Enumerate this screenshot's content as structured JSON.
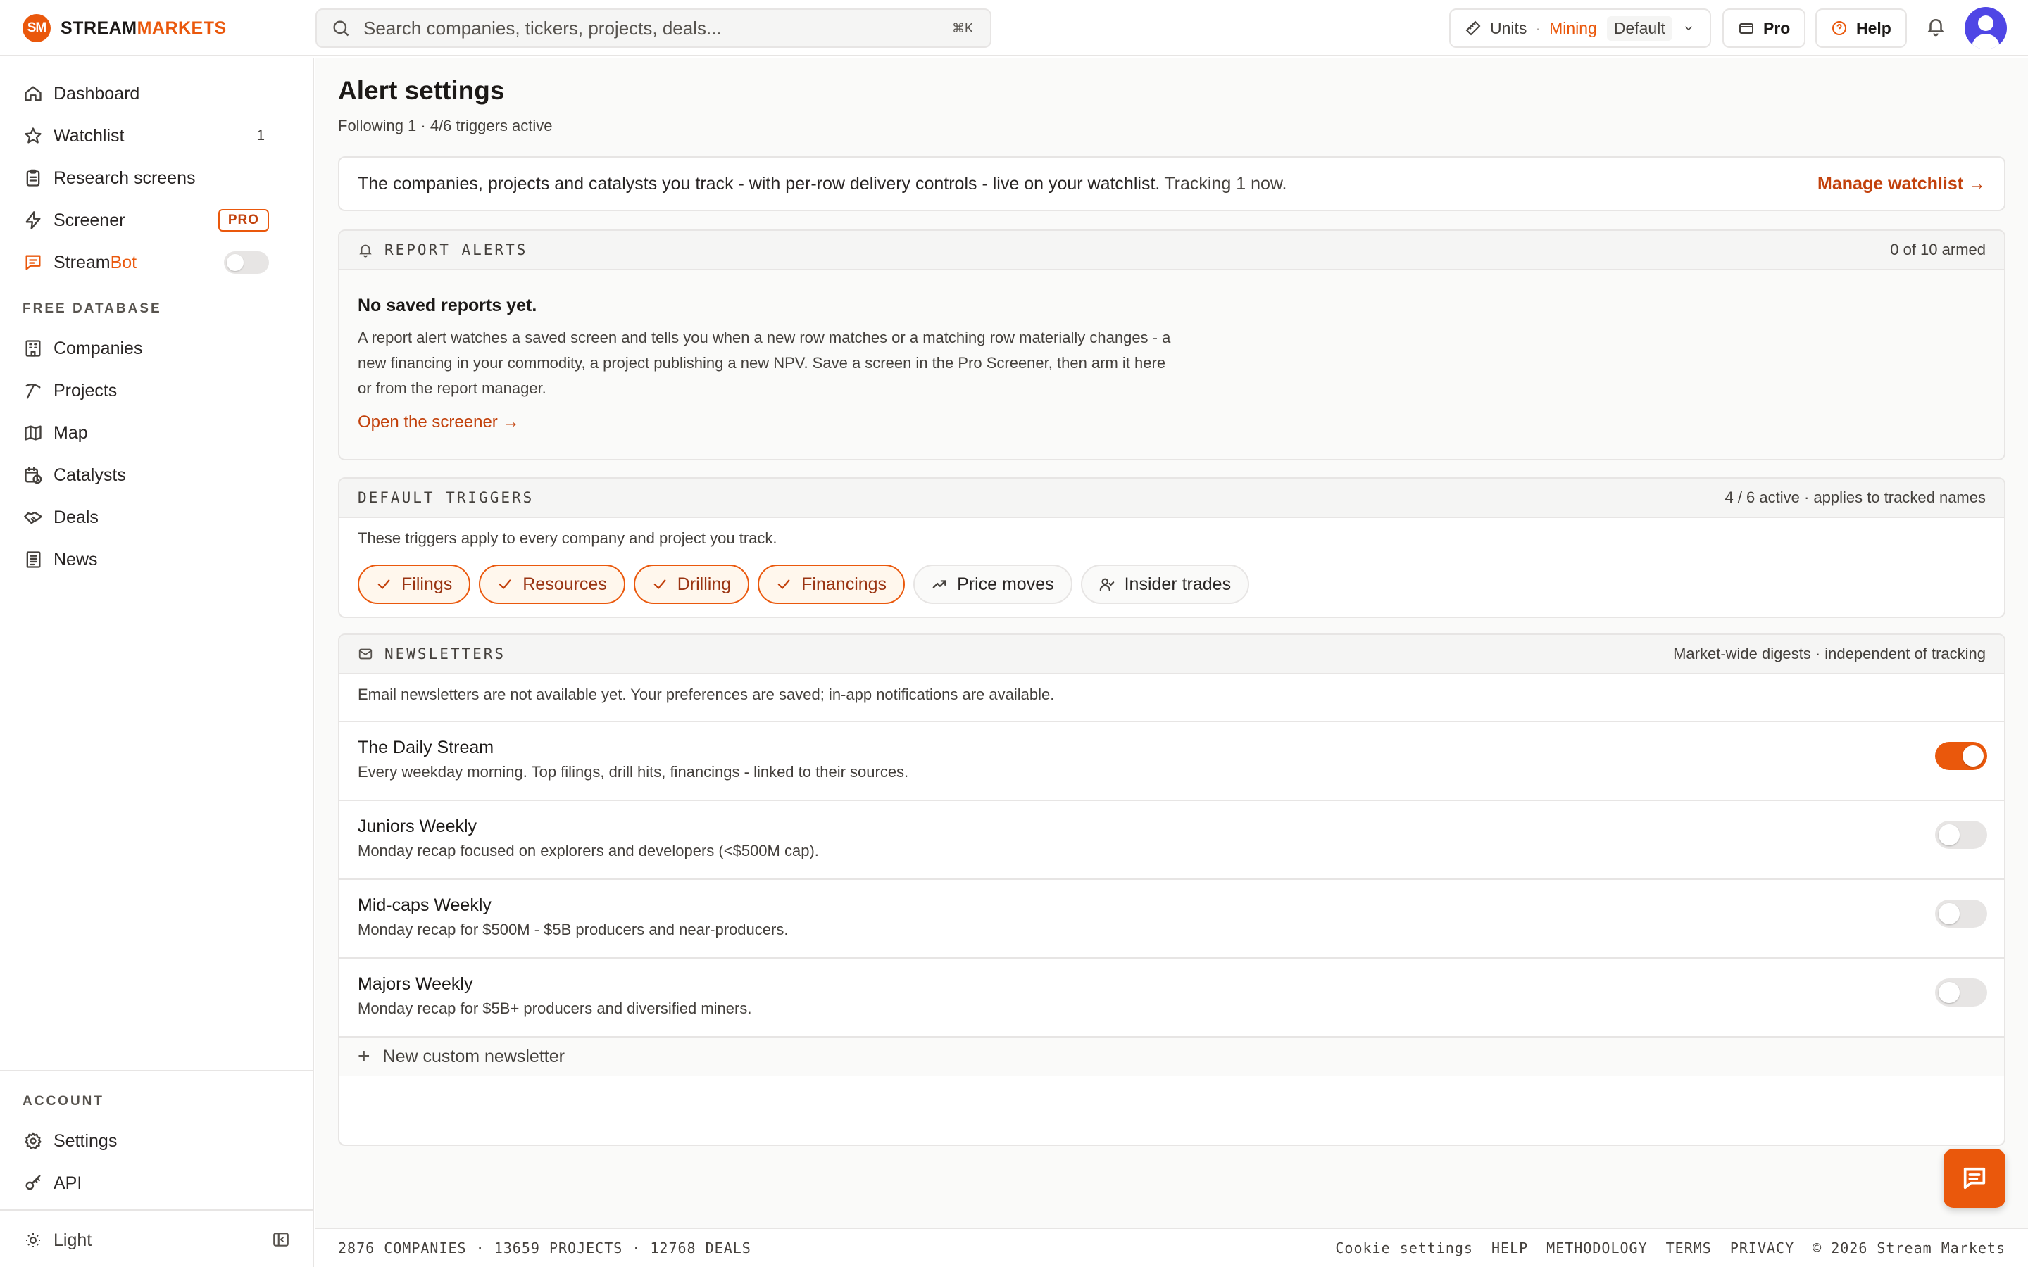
{
  "brand": {
    "badge": "SM",
    "name_a": "STREAM",
    "name_b": "MARKETS"
  },
  "search": {
    "placeholder": "Search companies, tickers, projects, deals...",
    "shortcut": "⌘K"
  },
  "topbar": {
    "units_label": "Units",
    "units_dot": "·",
    "units_sector": "Mining",
    "units_preset": "Default",
    "pro_label": "Pro",
    "help_label": "Help"
  },
  "sidebar": {
    "main_items": [
      {
        "label": "Dashboard",
        "icon": "home-icon"
      },
      {
        "label": "Watchlist",
        "icon": "star-icon",
        "count": "1"
      },
      {
        "label": "Research screens",
        "icon": "clipboard-icon"
      },
      {
        "label": "Screener",
        "icon": "lightning-icon",
        "badge": "PRO"
      },
      {
        "label_a": "Stream",
        "label_b": "Bot",
        "icon": "chat-icon"
      }
    ],
    "free_db_label": "FREE DATABASE",
    "db_items": [
      {
        "label": "Companies",
        "icon": "building-icon"
      },
      {
        "label": "Projects",
        "icon": "pickaxe-icon"
      },
      {
        "label": "Map",
        "icon": "map-icon"
      },
      {
        "label": "Catalysts",
        "icon": "calendar-clock-icon"
      },
      {
        "label": "Deals",
        "icon": "handshake-icon"
      },
      {
        "label": "News",
        "icon": "newspaper-icon"
      }
    ],
    "account_label": "ACCOUNT",
    "account_items": [
      {
        "label": "Settings",
        "icon": "gear-icon"
      },
      {
        "label": "API",
        "icon": "key-icon"
      }
    ],
    "theme_label": "Light"
  },
  "page": {
    "title": "Alert settings",
    "subtitle": "Following 1 · 4/6 triggers active"
  },
  "watch_info": {
    "text": "The companies, projects and catalysts you track - with per-row delivery controls - live on your watchlist.",
    "tracking": "Tracking 1 now.",
    "link": "Manage watchlist →"
  },
  "report_alerts": {
    "label": "REPORT ALERTS",
    "meta": "0 of 10 armed",
    "empty_title": "No saved reports yet.",
    "empty_desc": "A report alert watches a saved screen and tells you when a new row matches or a matching row materially changes - a new financing in your commodity, a project publishing a new NPV. Save a screen in the Pro Screener, then arm it here or from the report manager.",
    "link": "Open the screener →"
  },
  "default_triggers": {
    "label": "DEFAULT TRIGGERS",
    "meta": "4 / 6 active · applies to tracked names",
    "desc": "These triggers apply to every company and project you track.",
    "chips": [
      {
        "label": "Filings",
        "active": true
      },
      {
        "label": "Resources",
        "active": true
      },
      {
        "label": "Drilling",
        "active": true
      },
      {
        "label": "Financings",
        "active": true
      },
      {
        "label": "Price moves",
        "active": false
      },
      {
        "label": "Insider trades",
        "active": false
      }
    ]
  },
  "newsletters": {
    "label": "NEWSLETTERS",
    "meta": "Market-wide digests · independent of tracking",
    "note": "Email newsletters are not available yet. Your preferences are saved; in-app notifications are available.",
    "items": [
      {
        "title": "The Daily Stream",
        "desc": "Every weekday morning. Top filings, drill hits, financings - linked to their sources.",
        "enabled": true
      },
      {
        "title": "Juniors Weekly",
        "desc": "Monday recap focused on explorers and developers (<$500M cap).",
        "enabled": false
      },
      {
        "title": "Mid-caps Weekly",
        "desc": "Monday recap for $500M - $5B producers and near-producers.",
        "enabled": false
      },
      {
        "title": "Majors Weekly",
        "desc": "Monday recap for $5B+ producers and diversified miners.",
        "enabled": false
      }
    ],
    "new_label": "New custom newsletter"
  },
  "footer": {
    "stats": "2876 COMPANIES · 13659 PROJECTS · 12768 DEALS",
    "links": [
      "Cookie settings",
      "HELP",
      "METHODOLOGY",
      "TERMS",
      "PRIVACY",
      "© 2026 Stream Markets"
    ]
  },
  "colors": {
    "accent": "#ea580c",
    "accent_dark": "#c2410c",
    "avatar": "#4f46e5"
  }
}
